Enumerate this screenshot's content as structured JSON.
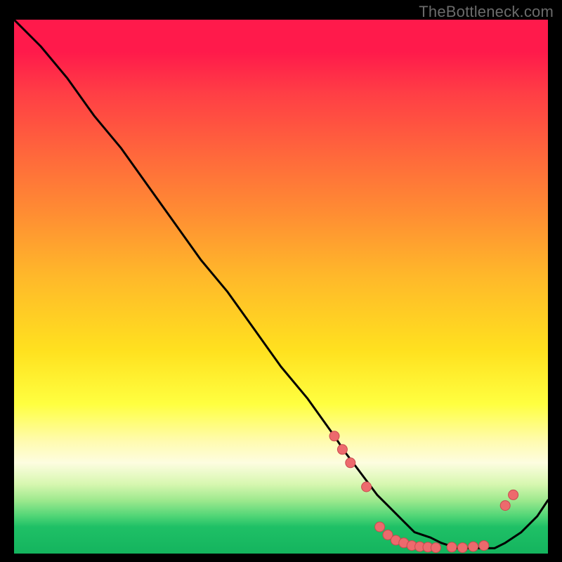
{
  "watermark": "TheBottleneck.com",
  "colors": {
    "page_bg": "#000000",
    "watermark": "#6b6b6b",
    "curve": "#000000",
    "marker_fill": "#ed6a6d",
    "marker_stroke": "#c94a4e"
  },
  "chart_data": {
    "type": "line",
    "title": "",
    "xlabel": "",
    "ylabel": "",
    "xlim": [
      0,
      100
    ],
    "ylim": [
      0,
      100
    ],
    "gradient_stops": [
      {
        "pos": 0,
        "color": "#ff1a4b"
      },
      {
        "pos": 14,
        "color": "#ff3f45"
      },
      {
        "pos": 26,
        "color": "#ff6a3b"
      },
      {
        "pos": 36,
        "color": "#ff8c33"
      },
      {
        "pos": 48,
        "color": "#ffb82a"
      },
      {
        "pos": 62,
        "color": "#ffe11f"
      },
      {
        "pos": 72,
        "color": "#ffff40"
      },
      {
        "pos": 83,
        "color": "#fdfde0"
      },
      {
        "pos": 90,
        "color": "#9ee98e"
      },
      {
        "pos": 95,
        "color": "#1fc066"
      },
      {
        "pos": 100,
        "color": "#14b45e"
      }
    ],
    "series": [
      {
        "name": "bottleneck-curve",
        "x": [
          0,
          5,
          10,
          15,
          20,
          25,
          30,
          35,
          40,
          45,
          50,
          55,
          60,
          62,
          65,
          68,
          70,
          73,
          75,
          78,
          80,
          83,
          85,
          88,
          90,
          92,
          95,
          98,
          100
        ],
        "y": [
          100,
          95,
          89,
          82,
          76,
          69,
          62,
          55,
          49,
          42,
          35,
          29,
          22,
          19,
          15,
          11,
          9,
          6,
          4,
          3,
          2,
          1,
          1,
          1,
          1,
          2,
          4,
          7,
          10
        ]
      }
    ],
    "markers": [
      {
        "x": 60.0,
        "y": 22.0
      },
      {
        "x": 61.5,
        "y": 19.5
      },
      {
        "x": 63.0,
        "y": 17.0
      },
      {
        "x": 66.0,
        "y": 12.5
      },
      {
        "x": 68.5,
        "y": 5.0
      },
      {
        "x": 70.0,
        "y": 3.5
      },
      {
        "x": 71.5,
        "y": 2.5
      },
      {
        "x": 73.0,
        "y": 2.0
      },
      {
        "x": 74.5,
        "y": 1.5
      },
      {
        "x": 76.0,
        "y": 1.3
      },
      {
        "x": 77.5,
        "y": 1.2
      },
      {
        "x": 79.0,
        "y": 1.1
      },
      {
        "x": 82.0,
        "y": 1.2
      },
      {
        "x": 84.0,
        "y": 1.1
      },
      {
        "x": 86.0,
        "y": 1.3
      },
      {
        "x": 88.0,
        "y": 1.5
      },
      {
        "x": 92.0,
        "y": 9.0
      },
      {
        "x": 93.5,
        "y": 11.0
      }
    ]
  }
}
